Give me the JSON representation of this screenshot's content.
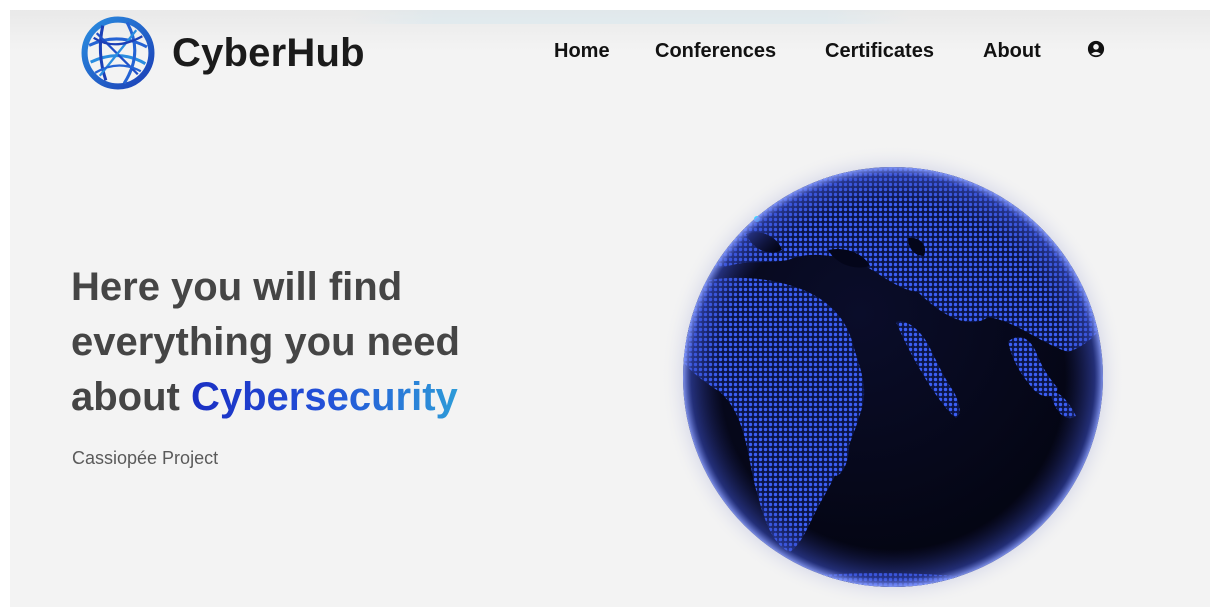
{
  "header": {
    "brand": "CyberHub",
    "nav": [
      "Home",
      "Conferences",
      "Certificates",
      "About"
    ]
  },
  "hero": {
    "headline_line1": "Here you will find",
    "headline_line2": "everything you need",
    "headline_line3_prefix": "about ",
    "headline_accent": "Cybersecurity",
    "subtitle": "Cassiopée Project"
  },
  "icons": {
    "logo": "globe-network-logo-icon",
    "account": "user-circle-icon"
  },
  "colors": {
    "accent_start": "#1a2fc3",
    "accent_end": "#2d9bd8",
    "globe_land": "#3b5ff5",
    "globe_ocean": "#05071a",
    "background": "#f3f3f3"
  }
}
